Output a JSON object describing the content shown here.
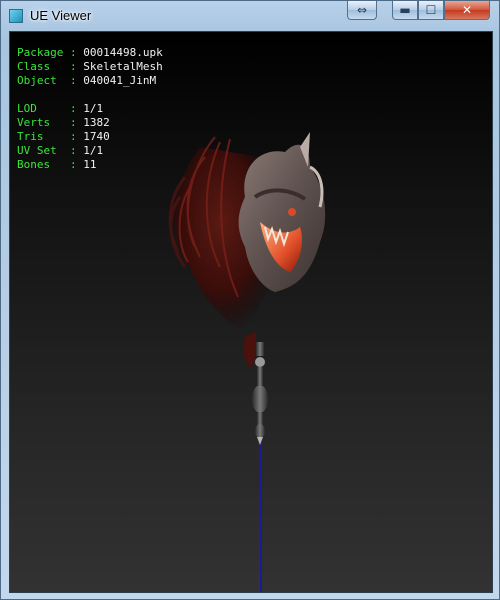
{
  "window": {
    "title": "UE Viewer",
    "app_icon": "app-icon",
    "buttons": {
      "swap": "⇔",
      "minimize": "▬",
      "maximize": "☐",
      "close": "✕"
    }
  },
  "info": [
    {
      "label": "Package",
      "pad": "Package",
      "value": "00014498.upk"
    },
    {
      "label": "Class  ",
      "pad": "",
      "value": "SkeletalMesh"
    },
    {
      "label": "Object ",
      "pad": "",
      "value": "040041_JinM"
    }
  ],
  "stats": [
    {
      "label": "LOD    ",
      "value": "1/1"
    },
    {
      "label": "Verts  ",
      "value": "1382"
    },
    {
      "label": "Tris   ",
      "value": "1740"
    },
    {
      "label": "UV Set ",
      "value": "1/1"
    },
    {
      "label": "Bones  ",
      "value": "11"
    }
  ],
  "separator": " : ",
  "colors": {
    "label": "#39e639",
    "value": "#f2f2f2",
    "axis": "#1a1a9a"
  }
}
